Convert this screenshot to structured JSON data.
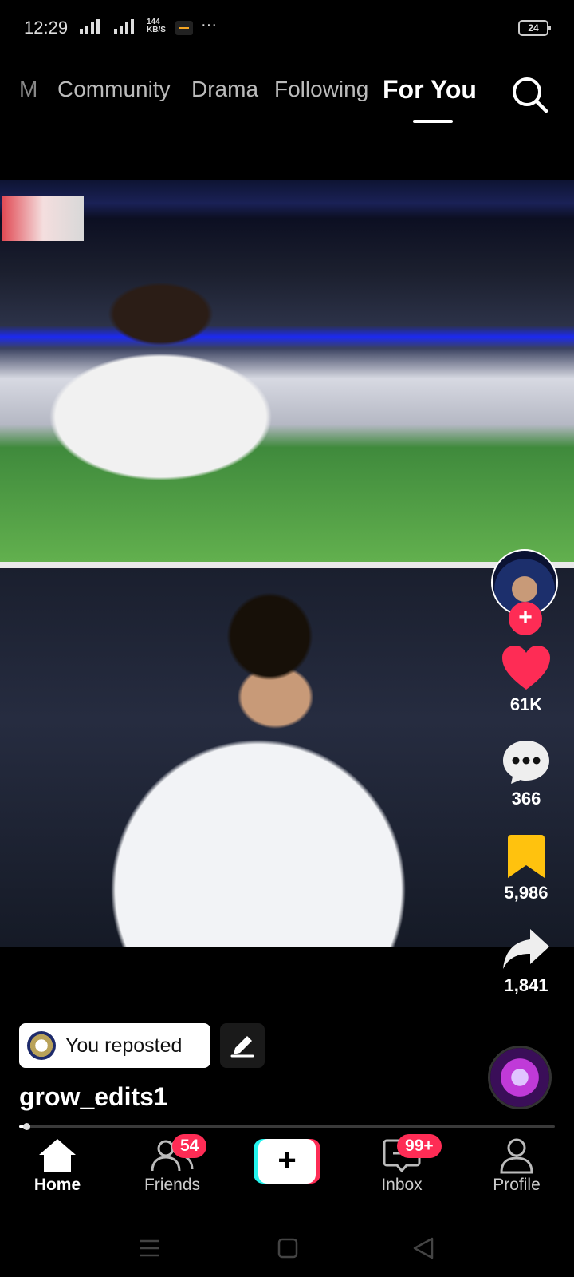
{
  "status_bar": {
    "time": "12:29",
    "network": "4G",
    "speed_value": "144",
    "speed_unit": "KB/S",
    "more": "···",
    "battery": "24"
  },
  "tabs": {
    "partial": "M",
    "community": "Community",
    "drama": "Drama",
    "following": "Following",
    "for_you": "For You",
    "search_icon": "search-icon"
  },
  "video": {
    "description": "Two stacked football clips"
  },
  "creator": {
    "avatar_icon": "avatar-icon",
    "follow_icon": "plus-icon"
  },
  "actions": {
    "likes": "61K",
    "comments": "366",
    "saves": "5,986",
    "shares": "1,841",
    "like_color": "#fe2c55",
    "save_color": "#ffc20e"
  },
  "post": {
    "repost_label": "You reposted",
    "username": "grow_edits1",
    "progress": 0.01
  },
  "bottom_nav": {
    "home": "Home",
    "friends": "Friends",
    "friends_badge": "54",
    "create": "+",
    "inbox": "Inbox",
    "inbox_badge": "99+",
    "profile": "Profile"
  }
}
